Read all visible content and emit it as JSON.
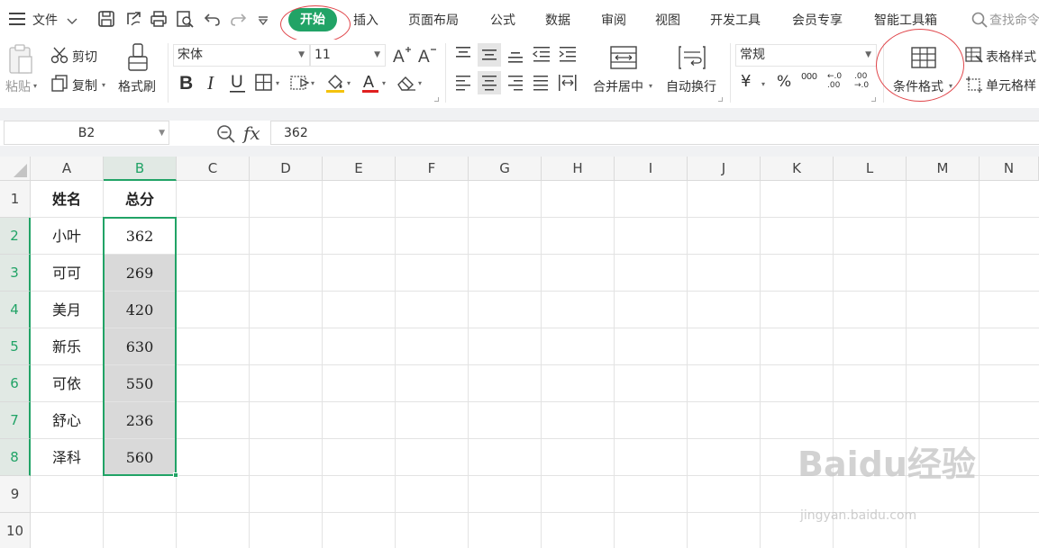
{
  "menubar": {
    "file": "文件",
    "tabs": [
      {
        "id": "start",
        "label": "开始",
        "active": true
      },
      {
        "id": "insert",
        "label": "插入"
      },
      {
        "id": "layout",
        "label": "页面布局"
      },
      {
        "id": "formula",
        "label": "公式"
      },
      {
        "id": "data",
        "label": "数据"
      },
      {
        "id": "review",
        "label": "审阅"
      },
      {
        "id": "view",
        "label": "视图"
      },
      {
        "id": "dev",
        "label": "开发工具"
      },
      {
        "id": "member",
        "label": "会员专享"
      },
      {
        "id": "smart",
        "label": "智能工具箱"
      }
    ],
    "search_placeholder": "查找命令",
    "accent": "#21a366"
  },
  "ribbon": {
    "paste": "粘贴",
    "cut": "剪切",
    "copy": "复制",
    "format_painter": "格式刷",
    "font_name": "宋体",
    "font_size": "11",
    "merge_center": "合并居中",
    "wrap_text": "自动换行",
    "number_format": "常规",
    "currency_symbol": "¥",
    "percent_symbol": "%",
    "thousands_symbol": "000",
    "decimal_increase": "←.0 .00",
    "decimal_decrease": ".00 →.0",
    "conditional_format": "条件格式",
    "table_style": "表格样式",
    "cell_style": "单元格样"
  },
  "formula_bar": {
    "name_box": "B2",
    "fx": "fx",
    "value": "362"
  },
  "sheet": {
    "columns": [
      "A",
      "B",
      "C",
      "D",
      "E",
      "F",
      "G",
      "H",
      "I",
      "J",
      "K",
      "L",
      "M",
      "N"
    ],
    "rows": [
      "1",
      "2",
      "3",
      "4",
      "5",
      "6",
      "7",
      "8",
      "9",
      "10"
    ],
    "header": {
      "name": "姓名",
      "score": "总分"
    },
    "data": [
      {
        "name": "小叶",
        "score": "362"
      },
      {
        "name": "可可",
        "score": "269"
      },
      {
        "name": "美月",
        "score": "420"
      },
      {
        "name": "新乐",
        "score": "630"
      },
      {
        "name": "可依",
        "score": "550"
      },
      {
        "name": "舒心",
        "score": "236"
      },
      {
        "name": "泽科",
        "score": "560"
      }
    ]
  },
  "watermark": {
    "brand": "Baidu经验",
    "url": "jingyan.baidu.com"
  }
}
